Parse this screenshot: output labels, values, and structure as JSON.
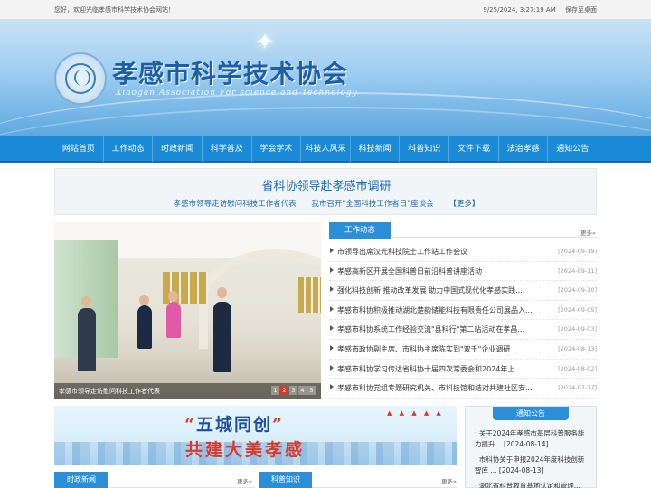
{
  "topbar": {
    "welcome": "您好，欢迎光临孝感市科学技术协会网站！",
    "datetime": "9/25/2024, 3:27:19 AM",
    "save_desktop": "保存至桌面"
  },
  "header": {
    "site_title": "孝感市科学技术协会",
    "site_subtitle": "Xiaogan Association For science and Technology"
  },
  "nav": {
    "items": [
      "网站首页",
      "工作动态",
      "时政新闻",
      "科学普及",
      "学会学术",
      "科技人风采",
      "科技新闻",
      "科普知识",
      "文件下载",
      "法治孝感",
      "通知公告"
    ]
  },
  "headline": {
    "title": "省科协领导赴孝感市调研",
    "links": [
      "孝感市领导走访慰问科技工作者代表",
      "我市召开\"全国科技工作者日\"座谈会",
      "【更多】"
    ]
  },
  "slideshow": {
    "caption": "孝感市领导走访慰问科技工作者代表",
    "pages": [
      "1",
      "2",
      "3",
      "4",
      "5"
    ],
    "active_page": 2
  },
  "work_news": {
    "tab": "工作动态",
    "more": "更多»",
    "items": [
      {
        "title": "市领导出席汉光科技院士工作站工作会议",
        "date": "[2024-09-19]"
      },
      {
        "title": "孝感高新区开展全国科普日前沿科普讲座活动",
        "date": "[2024-09-11]"
      },
      {
        "title": "强化科技创新 推动改革发展 助力中国式现代化孝感实践...",
        "date": "[2024-09-10]"
      },
      {
        "title": "孝感市科协积极推动湖北楚韵储能科技有限责任公司展品入...",
        "date": "[2024-09-05]"
      },
      {
        "title": "孝感市科协系统工作经验交流\"县科行\"第二站活动在孝昌...",
        "date": "[2024-09-03]"
      },
      {
        "title": "孝感市政协副主席、市科协主席陈实到\"双千\"企业调研",
        "date": "[2024-08-13]"
      },
      {
        "title": "孝感市科协学习传达省科协十届四次常委会和2024年上...",
        "date": "[2024-08-02]"
      },
      {
        "title": "孝感市科协党组专题研究机关、市科技馆和结对共建社区安...",
        "date": "[2024-07-17]"
      }
    ]
  },
  "promo": {
    "line1_open": "“",
    "line1": "五城同创",
    "line1_close": "”",
    "line2": "共建大美孝感"
  },
  "notice": {
    "head": "通知公告",
    "items": [
      "关于2024年孝感市基层科普服务能力提升... [2024-08-14]",
      "市科协关于申报2024年度科技创新智库 ... [2024-08-13]",
      "湖北省科普教育基地认定和管理..."
    ]
  },
  "bottom": {
    "politics_tab": "时政新闻",
    "politics_more": "更多»",
    "science_tab": "科普知识",
    "science_more": "更多»"
  },
  "colors": {
    "nav_blue": "#1a8ad6",
    "tab_blue": "#2b8fd8",
    "title_blue": "#1d5fa4",
    "accent_red": "#d8392b"
  }
}
